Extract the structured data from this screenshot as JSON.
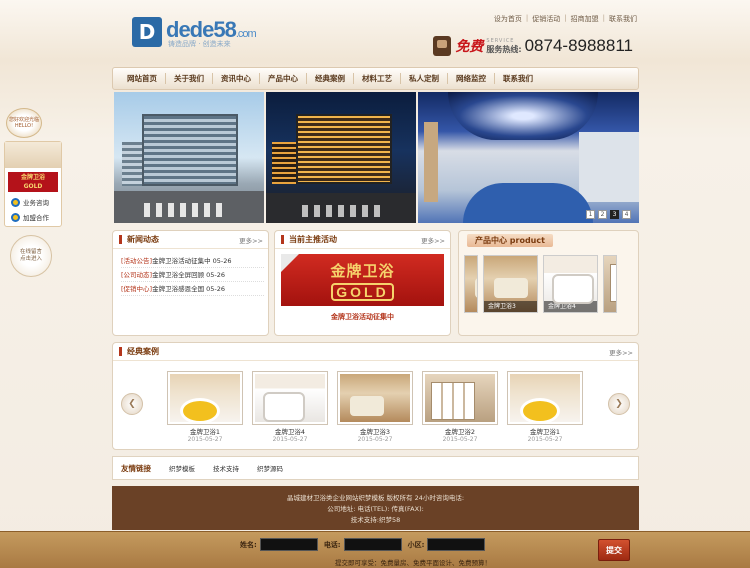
{
  "header": {
    "logo_mark": "D",
    "logo_text": "dede58",
    "logo_domain": ".com",
    "slogan": "铸造品牌 · 创造未来"
  },
  "top_links": [
    "设为首页",
    "促销活动",
    "招商加盟",
    "联系我们"
  ],
  "hotline": {
    "free": "免费",
    "service_en": "SERVICE",
    "service_cn": "服务热线:",
    "number": "0874-8988811"
  },
  "nav": [
    "网站首页",
    "关于我们",
    "资讯中心",
    "产品中心",
    "经典案例",
    "材料工艺",
    "私人定制",
    "网络监控",
    "联系我们"
  ],
  "banner": {
    "dots": [
      "1",
      "2",
      "3",
      "4"
    ],
    "active": 3
  },
  "news": {
    "title": "新闻动态",
    "more": "更多>>",
    "items": [
      {
        "tag": "[活动公告]",
        "text": "金牌卫浴活动征集中",
        "date": "05-26"
      },
      {
        "tag": "[公司动态]",
        "text": "金牌卫浴全屏回顾",
        "date": "05-26"
      },
      {
        "tag": "[促销中心]",
        "text": "金牌卫浴感恩全国",
        "date": "05-26"
      }
    ]
  },
  "activity": {
    "title": "当前主推活动",
    "more": "更多>>",
    "banner_cn": "金牌卫浴",
    "banner_en": "GOLD",
    "caption": "金牌卫浴活动征集中"
  },
  "products": {
    "title": "产品中心 product",
    "items": [
      {
        "name": ""
      },
      {
        "name": "金牌卫浴3"
      },
      {
        "name": ""
      },
      {
        "name": "金牌卫浴4"
      },
      {
        "name": ""
      }
    ]
  },
  "cases": {
    "title": "经典案例",
    "more": "更多>>",
    "items": [
      {
        "name": "金牌卫浴1",
        "date": "2015-05-27"
      },
      {
        "name": "金牌卫浴4",
        "date": "2015-05-27"
      },
      {
        "name": "金牌卫浴3",
        "date": "2015-05-27"
      },
      {
        "name": "金牌卫浴2",
        "date": "2015-05-27"
      },
      {
        "name": "金牌卫浴1",
        "date": "2015-05-27"
      }
    ]
  },
  "friend_links": {
    "title": "友情链接",
    "items": [
      "织梦模板",
      "技术支持",
      "织梦源码"
    ]
  },
  "footer": {
    "line1": "晶城建材卫浴类企业网站织梦模板 版权所有  24小时咨询电话:",
    "line2": "公司地址:     电话(TEL):     传真(FAX):",
    "line3": "技术支持:织梦58"
  },
  "message": {
    "name_label": "姓名:",
    "phone_label": "电话:",
    "area_label": "小区:",
    "submit": "提交",
    "note": "提交即可享受：免费量房、免费平面设计、免费预算！"
  },
  "float": {
    "hello_top": "您好欢迎光临",
    "hello": "HELLO!",
    "brand_cn": "金牌卫浴",
    "brand_en": "GOLD",
    "consult": "业务咨询",
    "join": "加盟合作",
    "msg_line1": "在线留言",
    "msg_line2": "点击进入"
  }
}
